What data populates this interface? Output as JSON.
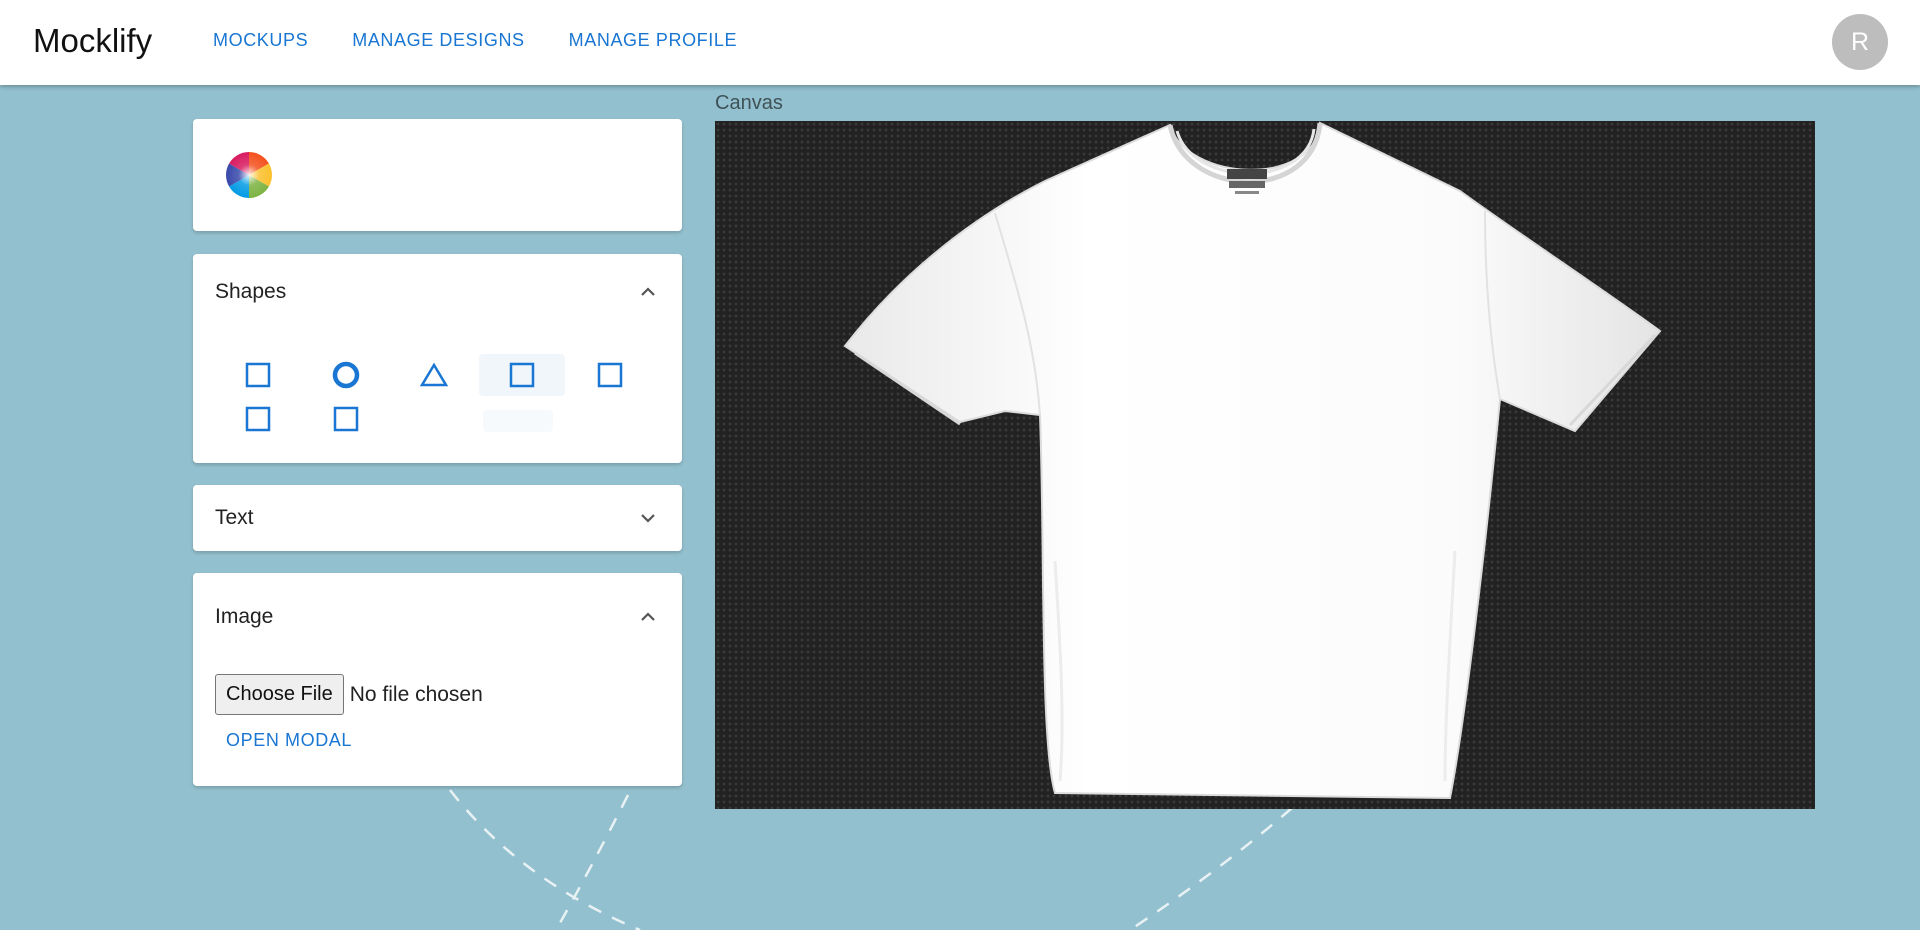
{
  "app": {
    "brand": "Mocklify"
  },
  "nav": {
    "items": [
      "MOCKUPS",
      "MANAGE DESIGNS",
      "MANAGE PROFILE"
    ]
  },
  "user": {
    "avatar_initial": "R"
  },
  "colors": {
    "accent": "#1976d2",
    "background": "#93c0ce",
    "canvas_bg": "#222222",
    "card": "#ffffff"
  },
  "sidebar": {
    "color_picker": {
      "icon": "color-wheel-icon"
    },
    "shapes": {
      "title": "Shapes",
      "expanded": true,
      "items": [
        "square",
        "circle",
        "triangle",
        "square",
        "square",
        "square",
        "square"
      ]
    },
    "text": {
      "title": "Text",
      "expanded": false
    },
    "image": {
      "title": "Image",
      "expanded": true,
      "file_button": "Choose File",
      "file_status": "No file chosen",
      "modal_link": "OPEN MODAL"
    }
  },
  "canvas": {
    "label": "Canvas",
    "content": "white t-shirt mockup"
  }
}
